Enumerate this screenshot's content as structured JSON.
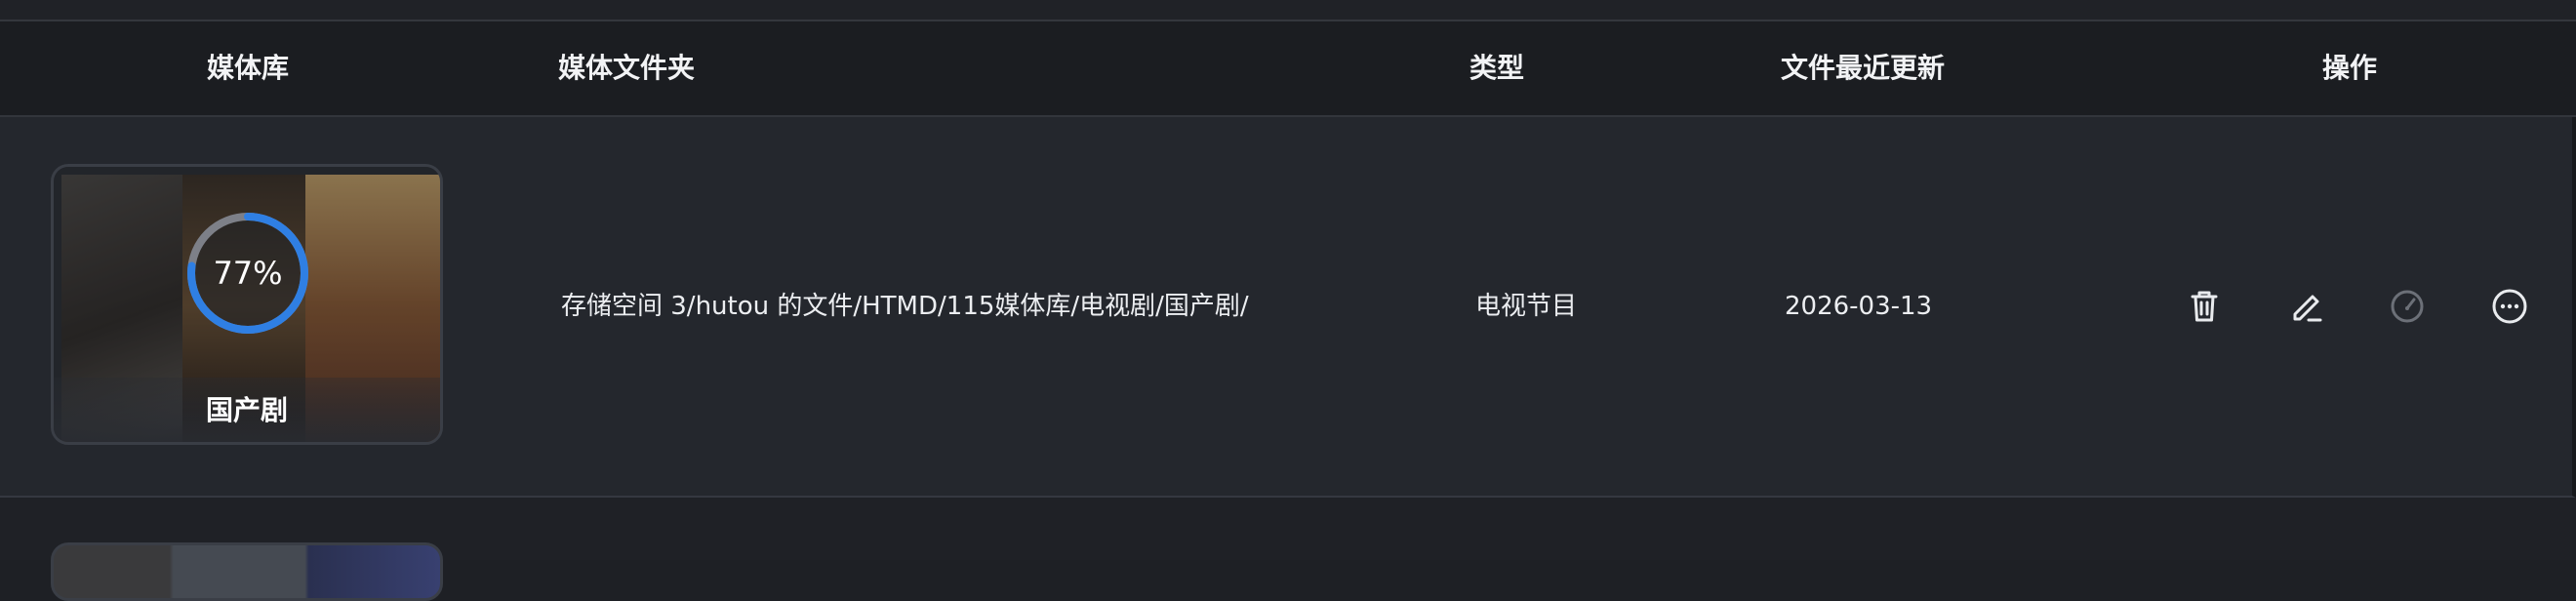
{
  "table": {
    "headers": {
      "library": "媒体库",
      "folder": "媒体文件夹",
      "type": "类型",
      "updated": "文件最近更新",
      "actions": "操作"
    },
    "rows": [
      {
        "library_name": "国产剧",
        "scan_progress_label": "77%",
        "scan_progress": 0.77,
        "folder_path": "存储空间 3/hutou 的文件/HTMD/115媒体库/电视剧/国产剧/",
        "type": "电视节目",
        "updated": "2026-03-13",
        "actions": [
          "trash-icon",
          "edit-icon",
          "scan-gauge-icon",
          "more-icon"
        ]
      }
    ]
  },
  "colors": {
    "background": "#1e2025",
    "header_bg": "#1b1d21",
    "row_bg": "#24272d",
    "progress_ring": "#2f7fe3",
    "text": "#e9ebee",
    "disabled_icon": "#6c7078"
  }
}
